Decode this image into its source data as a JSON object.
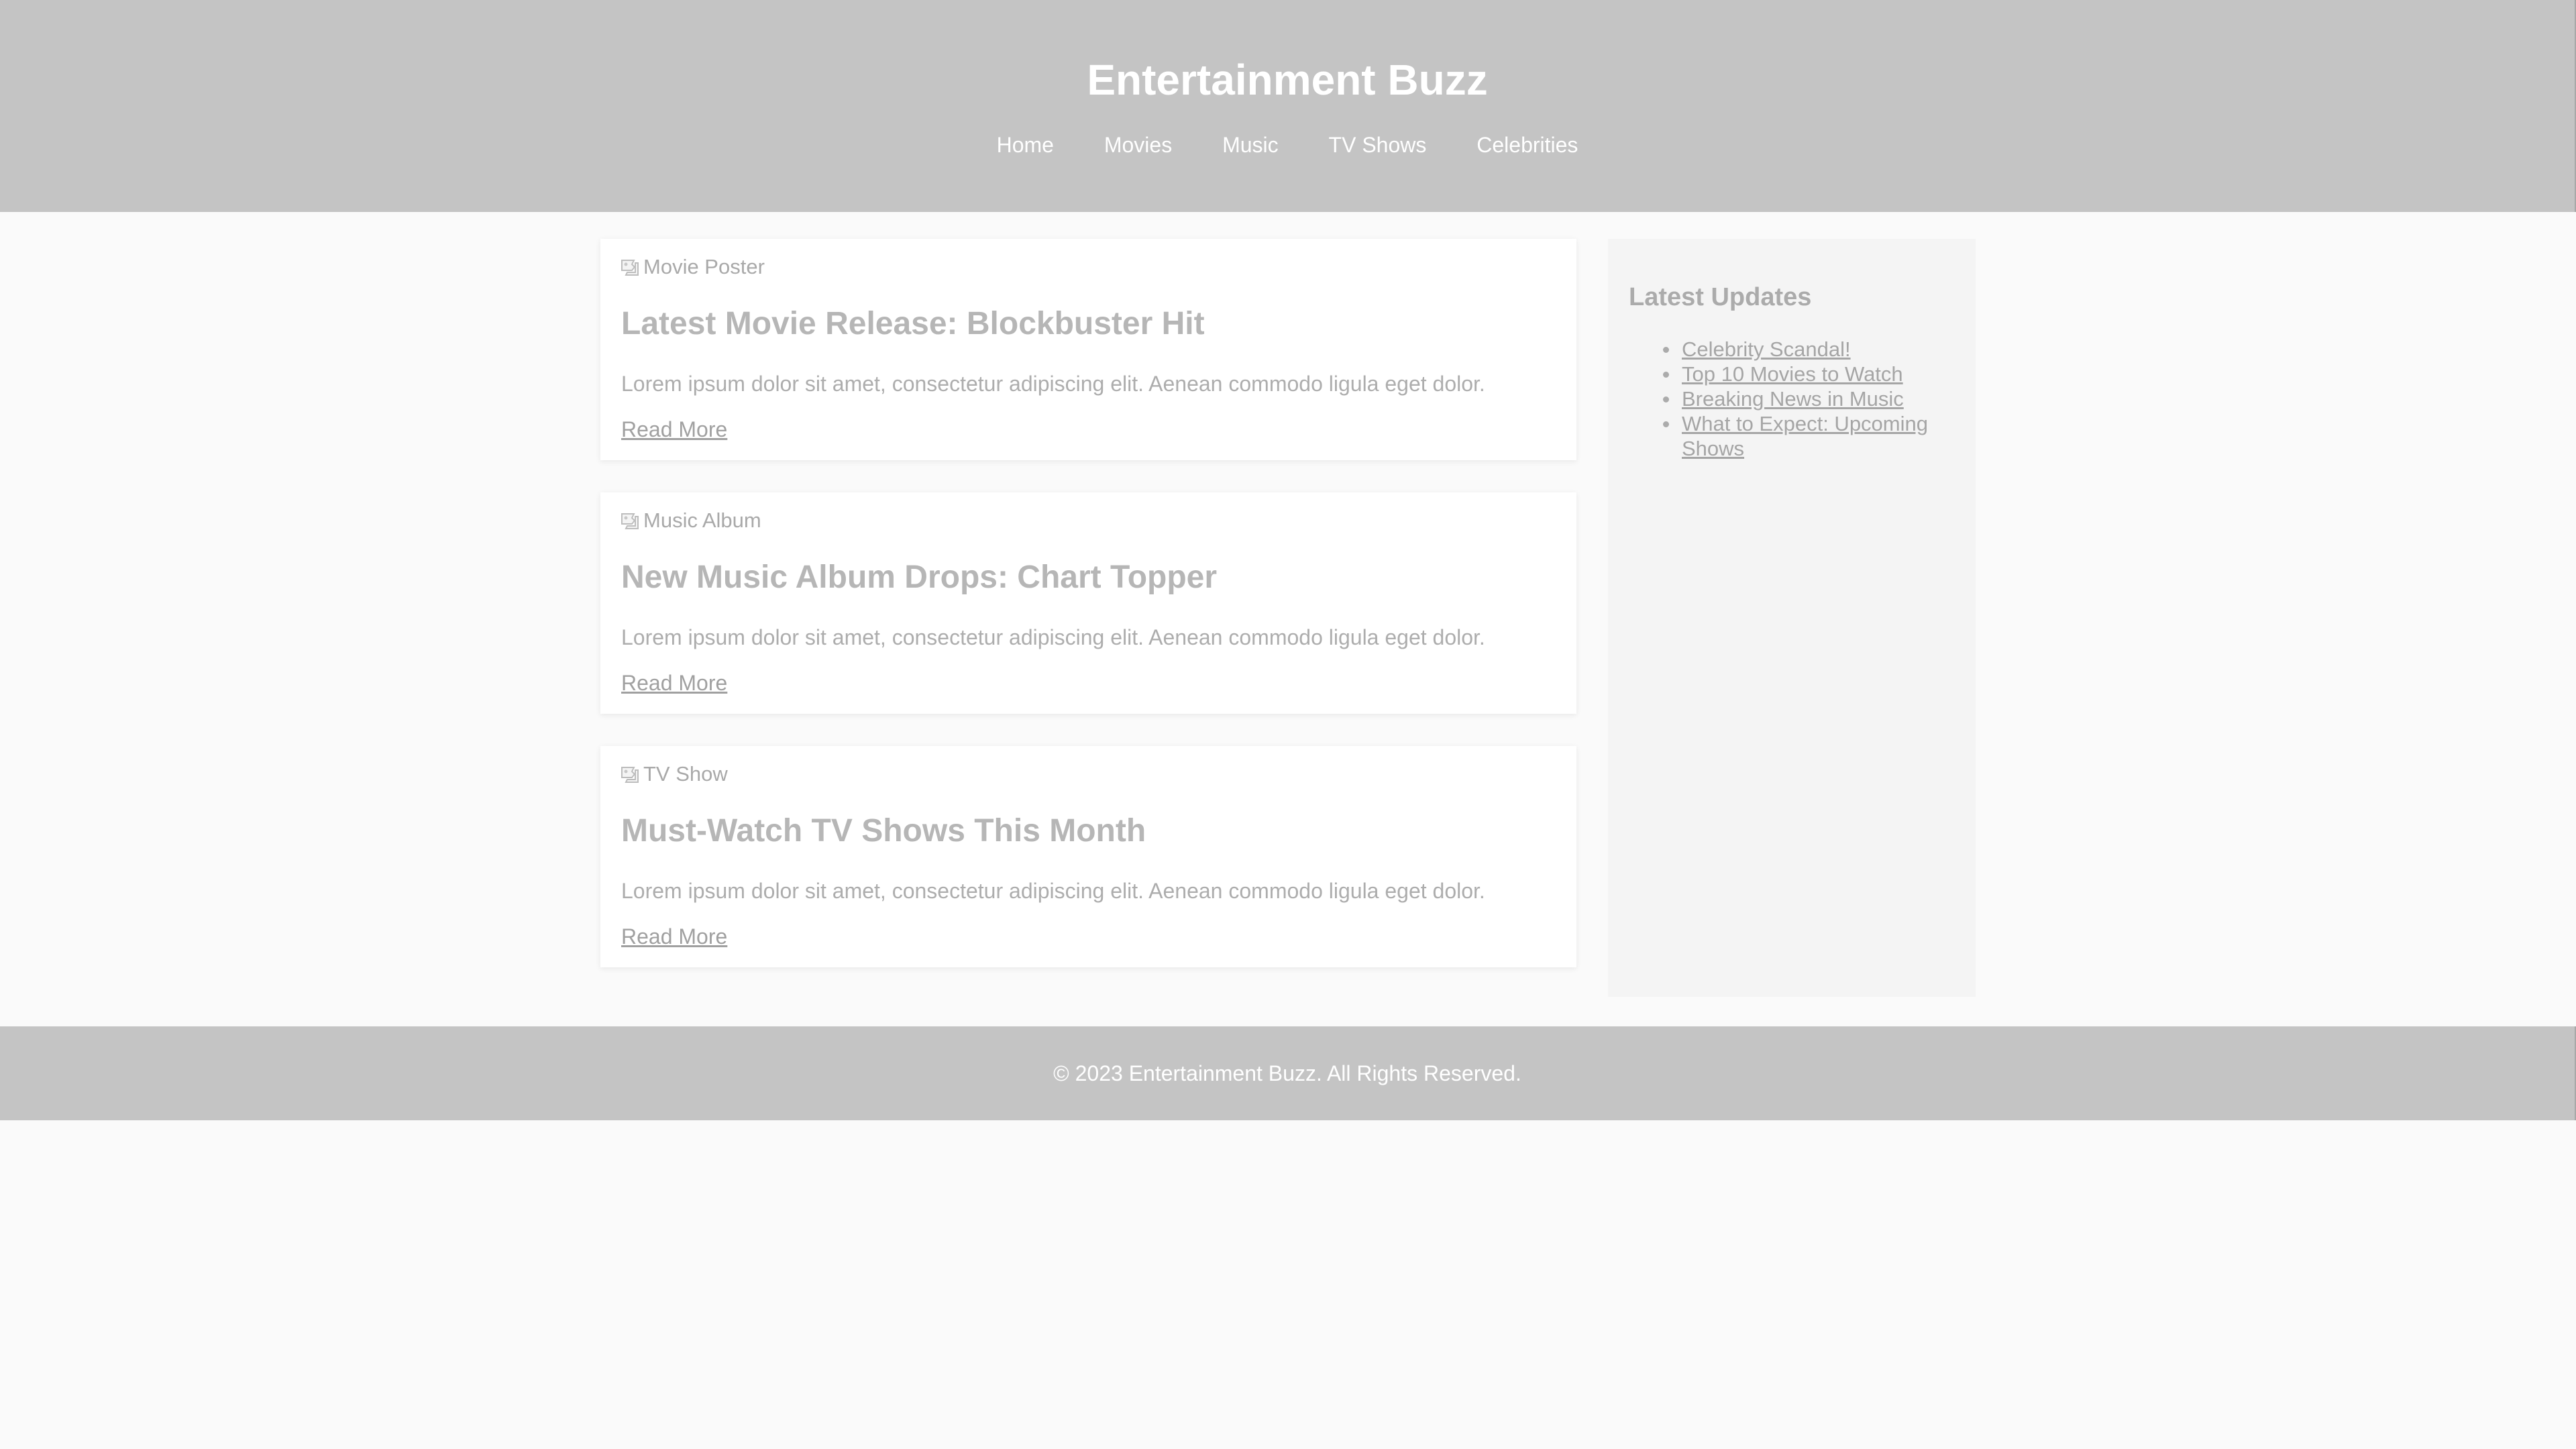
{
  "header": {
    "title": "Entertainment Buzz",
    "nav": [
      "Home",
      "Movies",
      "Music",
      "TV Shows",
      "Celebrities"
    ]
  },
  "articles": [
    {
      "image_alt": "Movie Poster",
      "title": "Latest Movie Release: Blockbuster Hit",
      "text": "Lorem ipsum dolor sit amet, consectetur adipiscing elit. Aenean commodo ligula eget dolor.",
      "link": "Read More"
    },
    {
      "image_alt": "Music Album",
      "title": "New Music Album Drops: Chart Topper",
      "text": "Lorem ipsum dolor sit amet, consectetur adipiscing elit. Aenean commodo ligula eget dolor.",
      "link": "Read More"
    },
    {
      "image_alt": "TV Show",
      "title": "Must-Watch TV Shows This Month",
      "text": "Lorem ipsum dolor sit amet, consectetur adipiscing elit. Aenean commodo ligula eget dolor.",
      "link": "Read More"
    }
  ],
  "sidebar": {
    "title": "Latest Updates",
    "items": [
      "Celebrity Scandal!",
      "Top 10 Movies to Watch",
      "Breaking News in Music",
      "What to Expect: Upcoming Shows"
    ]
  },
  "footer": {
    "text": "© 2023 Entertainment Buzz. All Rights Reserved."
  },
  "colors": {
    "header_bg": "#c4c4c4",
    "page_bg": "#fafafa",
    "sidebar_bg": "#f4f4f4"
  }
}
